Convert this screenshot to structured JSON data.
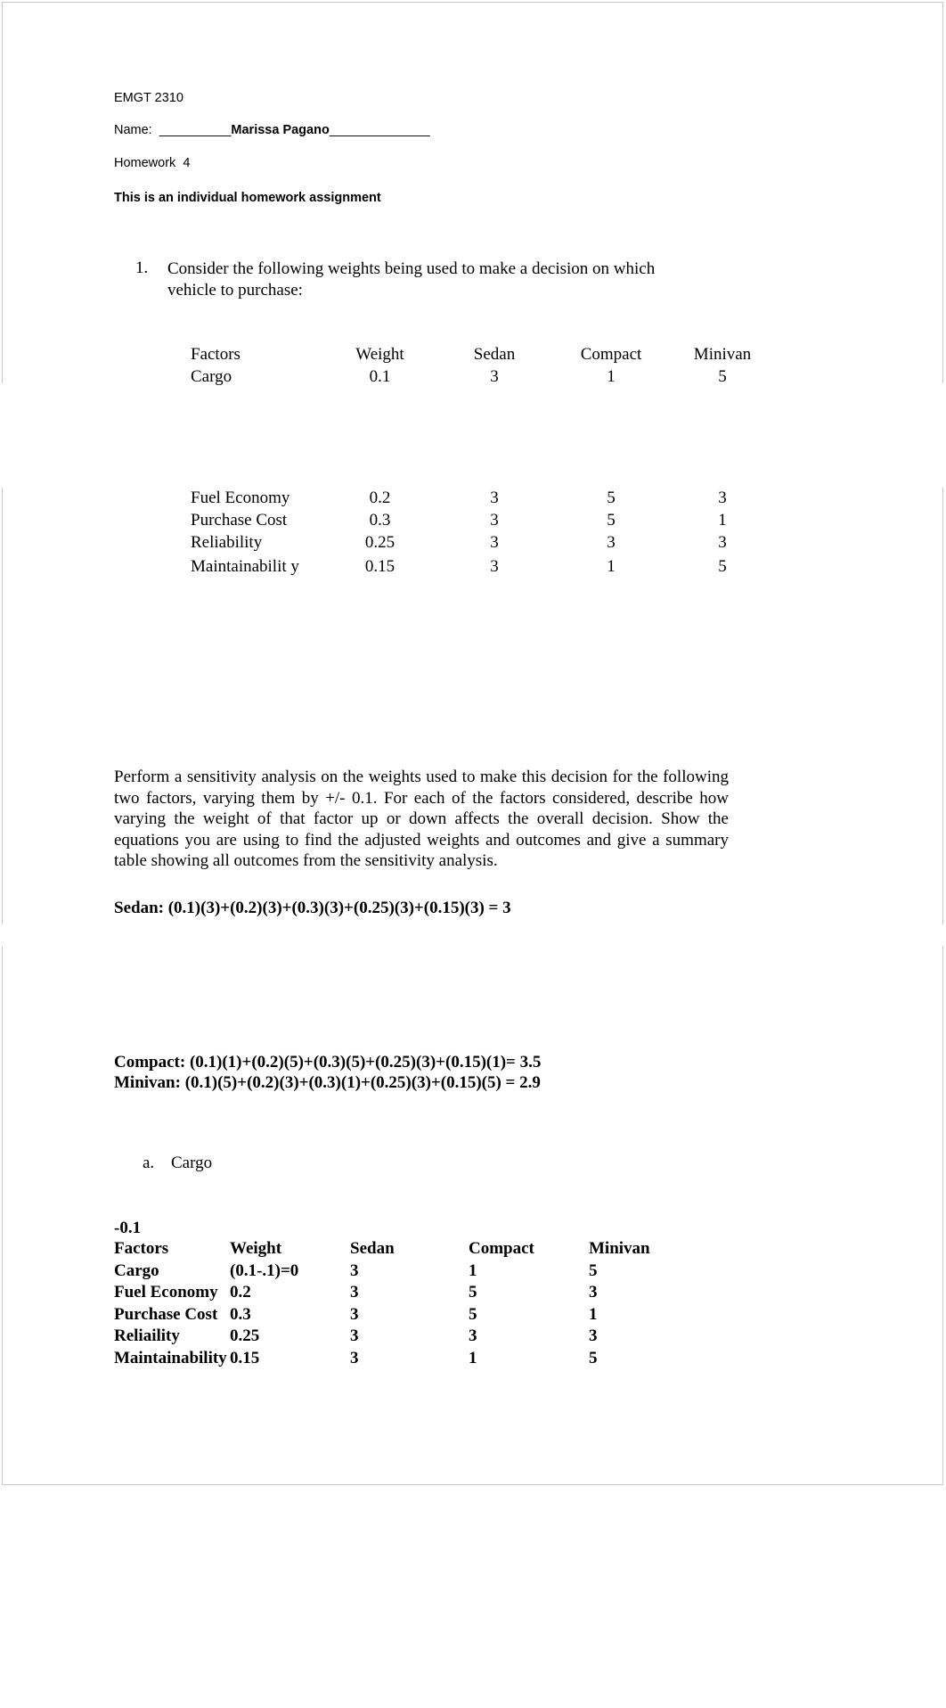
{
  "document": {
    "broken_image_alt": "image-placeholder",
    "header": {
      "course": "EMGT 2310",
      "name_line_prefix": "Name:  __________",
      "student_name": "Marissa Pagano",
      "name_line_suffix": "______________",
      "assignment": "Homework  4",
      "note": "This is an individual homework assignment"
    },
    "question1": {
      "number": "1.",
      "text": "Consider the following weights being used to make a decision on which vehicle to purchase:"
    },
    "weights_table": {
      "headers": [
        "Factors",
        "Weight",
        "Sedan",
        "Compact",
        "Minivan"
      ],
      "rows": [
        {
          "factor": "Cargo",
          "weight": "0.1",
          "sedan": "3",
          "compact": "1",
          "minivan": "5"
        },
        {
          "factor": "Fuel Economy",
          "weight": "0.2",
          "sedan": "3",
          "compact": "5",
          "minivan": "3"
        },
        {
          "factor": "Purchase Cost",
          "weight": "0.3",
          "sedan": "3",
          "compact": "5",
          "minivan": "1"
        },
        {
          "factor": "Reliability",
          "weight": "0.25",
          "sedan": "3",
          "compact": "3",
          "minivan": "3"
        },
        {
          "factor": "Maintainabilit\ny",
          "weight": "0.15",
          "sedan": "3",
          "compact": "1",
          "minivan": "5"
        }
      ]
    },
    "instructions": "Perform a sensitivity analysis on the weights used to make this decision for the following two factors, varying them by +/- 0.1. For each of the factors considered, describe how varying the weight of that factor up or down affects the overall decision. Show the equations you are using to find the adjusted weights and outcomes and give a summary table showing all outcomes from the sensitivity analysis.",
    "equations": {
      "sedan": "Sedan: (0.1)(3)+(0.2)(3)+(0.3)(3)+(0.25)(3)+(0.15)(3) = 3",
      "compact": "Compact: (0.1)(1)+(0.2)(5)+(0.3)(5)+(0.25)(3)+(0.15)(1)= 3.5",
      "minivan": "Minivan: (0.1)(5)+(0.2)(3)+(0.3)(1)+(0.25)(3)+(0.15)(5) = 2.9"
    },
    "subpart_a": {
      "letter": "a.",
      "label": "Cargo"
    },
    "adjustment_label": "-0.1",
    "summary_table": {
      "headers": [
        "Factors",
        "Weight",
        "Sedan",
        "Compact",
        "Minivan"
      ],
      "rows": [
        {
          "factor": "Cargo",
          "weight": "(0.1-.1)=0",
          "sedan": "3",
          "compact": "1",
          "minivan": "5"
        },
        {
          "factor": "Fuel Economy",
          "weight": "0.2",
          "sedan": "3",
          "compact": "5",
          "minivan": "3"
        },
        {
          "factor": "Purchase Cost",
          "weight": "0.3",
          "sedan": "3",
          "compact": "5",
          "minivan": "1"
        },
        {
          "factor": "Reliaility",
          "weight": "0.25",
          "sedan": "3",
          "compact": "3",
          "minivan": "3"
        },
        {
          "factor": "Maintainability",
          "weight": "0.15",
          "sedan": "3",
          "compact": "1",
          "minivan": "5"
        }
      ]
    }
  }
}
